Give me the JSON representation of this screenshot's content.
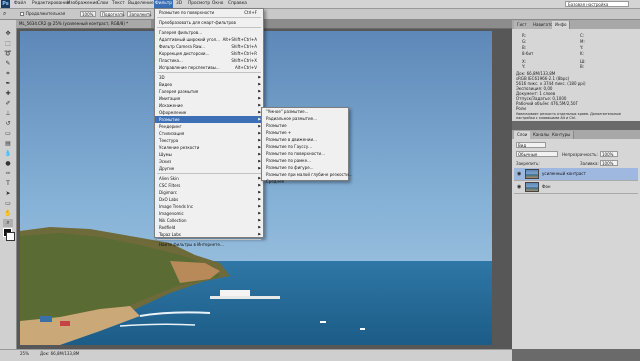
{
  "menubar": {
    "logo": "Ps",
    "items": [
      "Файл",
      "Редактирование",
      "Изображение",
      "Слои",
      "Текст",
      "Выделение",
      "Фильтр",
      "3D",
      "Просмотр",
      "Окно",
      "Справка"
    ],
    "workspace": "Базовая настройка"
  },
  "options": {
    "mode_label": "Продолжительная",
    "zoom": "100%",
    "fit_button": "Подогнать",
    "fill_button": "Заполнить",
    "fullscreen_button": "Полный экран"
  },
  "document_tab": "ML_5634.CR2 @ 25% (усиленный контраст, RGB/8) *",
  "status": {
    "zoom": "25%",
    "doc": "Док: 66,8M/133,8M"
  },
  "filter_menu": {
    "top": [
      {
        "label": "Размытие по поверхности",
        "shortcut": "Ctrl+F"
      },
      {
        "label": "Преобразовать для смарт-фильтров",
        "shortcut": ""
      }
    ],
    "group2": [
      {
        "label": "Галерея фильтров...",
        "shortcut": ""
      },
      {
        "label": "Адаптивный широкий угол...",
        "shortcut": "Alt+Shift+Ctrl+A"
      },
      {
        "label": "Фильтр Camera Raw...",
        "shortcut": "Shift+Ctrl+A"
      },
      {
        "label": "Коррекция дисторсии...",
        "shortcut": "Shift+Ctrl+R"
      },
      {
        "label": "Пластика...",
        "shortcut": "Shift+Ctrl+X"
      },
      {
        "label": "Исправление перспективы...",
        "shortcut": "Alt+Ctrl+V"
      }
    ],
    "group3": [
      "3D",
      "Видео",
      "Галерея размытия",
      "Имитация",
      "Искажение",
      "Оформление",
      "Размытие",
      "Рендеринг",
      "Стилизация",
      "Текстура",
      "Усиление резкости",
      "Шумы",
      "Эскиз",
      "Другие"
    ],
    "group4": [
      "Alien Skin",
      "CSC Filters",
      "Digimarc",
      "DxO Labs",
      "Image Trends Inc",
      "Imagenomic",
      "Nik Collection",
      "Redfield",
      "Topaz Labs"
    ],
    "online": "Найти фильтры в Интернете..."
  },
  "blur_submenu": [
    "\"Умное\" размытие...",
    "Радиальное размытие...",
    "Размытие",
    "Размытие +",
    "Размытие в движении...",
    "Размытие по Гауссу...",
    "Размытие по поверхности...",
    "Размытие по рамке...",
    "Размытие по фигуре...",
    "Размытие при малой глубине резкости...",
    "Среднее"
  ],
  "panels": {
    "top_tabs": [
      "Гист",
      "Навигатор",
      "Инфо"
    ],
    "info": {
      "r": "R:",
      "g": "G:",
      "b": "B:",
      "bits": "8-бит",
      "c": "C:",
      "m": "M:",
      "y": "Y:",
      "k": "K:",
      "x": "X:",
      "y2": "Y:",
      "w": "Ш:",
      "h": "В:",
      "doc_line1": "Док: 66,8M/133,8M",
      "doc_line2": "sRGB IEC61966-2.1 (8bpc)",
      "doc_line3": "5616 пикс. x 3744 пикс. (180 ppi)",
      "doc_line4": "Экспозиция: 0,00",
      "doc_line5": "Документ: 1 слоев",
      "doc_line6": "Отпуск/Задатье: 0,1000",
      "doc_line7": "Рабочий объём: 476,5M/2,50Г",
      "doc_line8": "Роли",
      "hint": "Увеличивает резкость отдельных краев. Дополнительные настройки с клавишами Alt и Ctrl."
    },
    "layers_tabs": [
      "Слои",
      "Каналы",
      "Контуры"
    ],
    "layers": {
      "kind": "Вид",
      "blend": "Обычные",
      "opacity_label": "Непрозрачность:",
      "opacity": "100%",
      "lock_label": "Закрепить:",
      "fill_label": "Заливка:",
      "fill": "100%",
      "items": [
        "усиленный контраст",
        "Фон"
      ]
    }
  },
  "colors": {
    "accent": "#3d6fb6",
    "menu_bg": "#f0f0f0",
    "panel": "#d6d6d6"
  }
}
